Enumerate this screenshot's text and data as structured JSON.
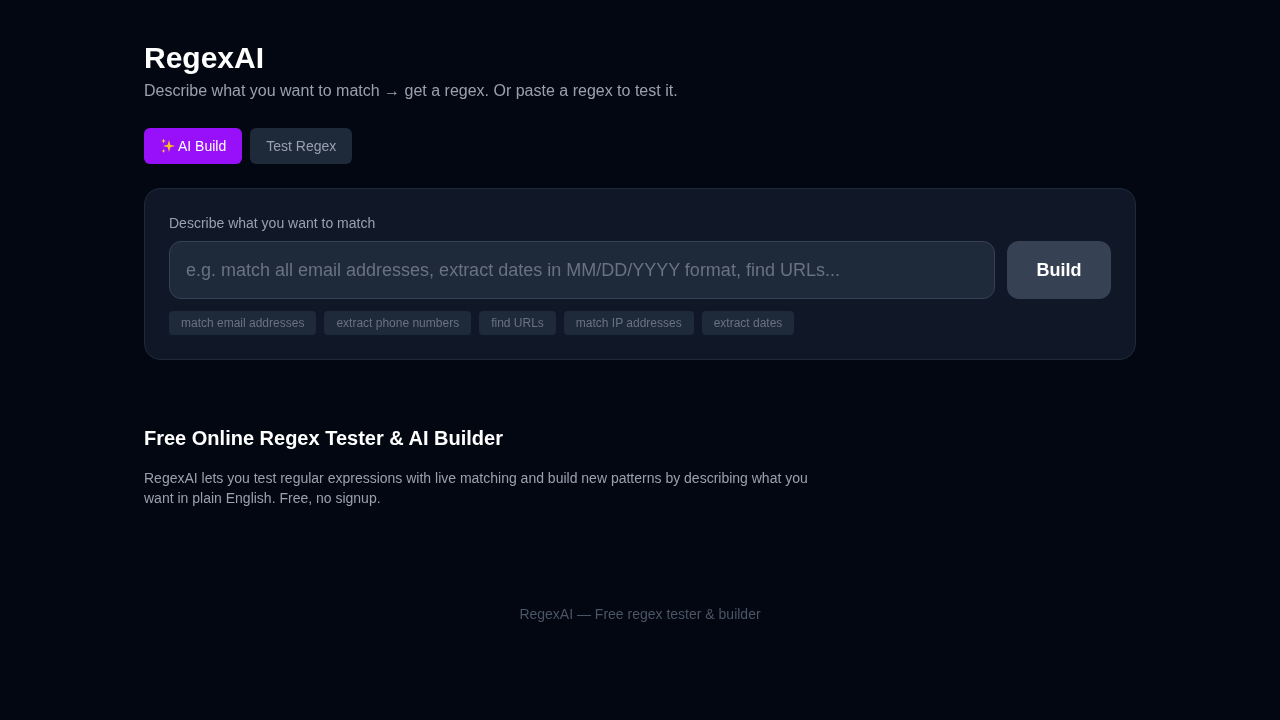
{
  "header": {
    "title": "RegexAI",
    "subtitle": "Describe what you want to match → get a regex. Or paste a regex to test it."
  },
  "tabs": [
    {
      "label": "AI Build",
      "selected": true,
      "kind": "ai"
    },
    {
      "label": "Test Regex",
      "selected": false,
      "kind": "plain"
    }
  ],
  "builder": {
    "label": "Describe what you want to match",
    "placeholder": "e.g. match all email addresses, extract dates in MM/DD/YYYY format, find URLs...",
    "button": "Build",
    "examples": [
      "match email addresses",
      "extract phone numbers",
      "find URLs",
      "match IP addresses",
      "extract dates"
    ]
  },
  "about": {
    "heading": "Free Online Regex Tester & AI Builder",
    "text": "RegexAI lets you test regular expressions with live matching and build new patterns by describing what you want in plain English. Free, no signup."
  },
  "footer": "RegexAI — Free regex tester & builder"
}
